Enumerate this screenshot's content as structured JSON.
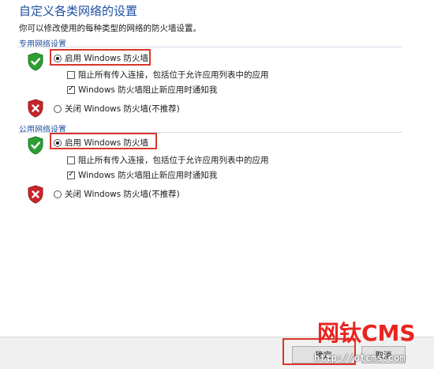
{
  "header": {
    "title": "自定义各类网络的设置",
    "subtitle": "你可以修改使用的每种类型的网络的防火墙设置。"
  },
  "sections": [
    {
      "header": "专用网络设置",
      "enable": {
        "label": "启用 Windows 防火墙",
        "selected": true
      },
      "block_all": {
        "label": "阻止所有传入连接，包括位于允许应用列表中的应用",
        "checked": false
      },
      "notify": {
        "label": "Windows 防火墙阻止新应用时通知我",
        "checked": true
      },
      "disable": {
        "label": "关闭 Windows 防火墙(不推荐)",
        "selected": false
      }
    },
    {
      "header": "公用网络设置",
      "enable": {
        "label": "启用 Windows 防火墙",
        "selected": true
      },
      "block_all": {
        "label": "阻止所有传入连接，包括位于允许应用列表中的应用",
        "checked": false
      },
      "notify": {
        "label": "Windows 防火墙阻止新应用时通知我",
        "checked": true
      },
      "disable": {
        "label": "关闭 Windows 防火墙(不推荐)",
        "selected": false
      }
    }
  ],
  "footer": {
    "ok_label": "确定",
    "cancel_label": "取消"
  },
  "watermark": {
    "brand": "网钛CMS",
    "url": "http://otcms.com"
  },
  "colors": {
    "title": "#1f4fa0",
    "shield_ok": "#2e9e34",
    "shield_bad": "#c8252c",
    "highlight": "#d9362b"
  },
  "icons": {
    "enabled": "shield-check-icon",
    "disabled": "shield-x-icon"
  }
}
